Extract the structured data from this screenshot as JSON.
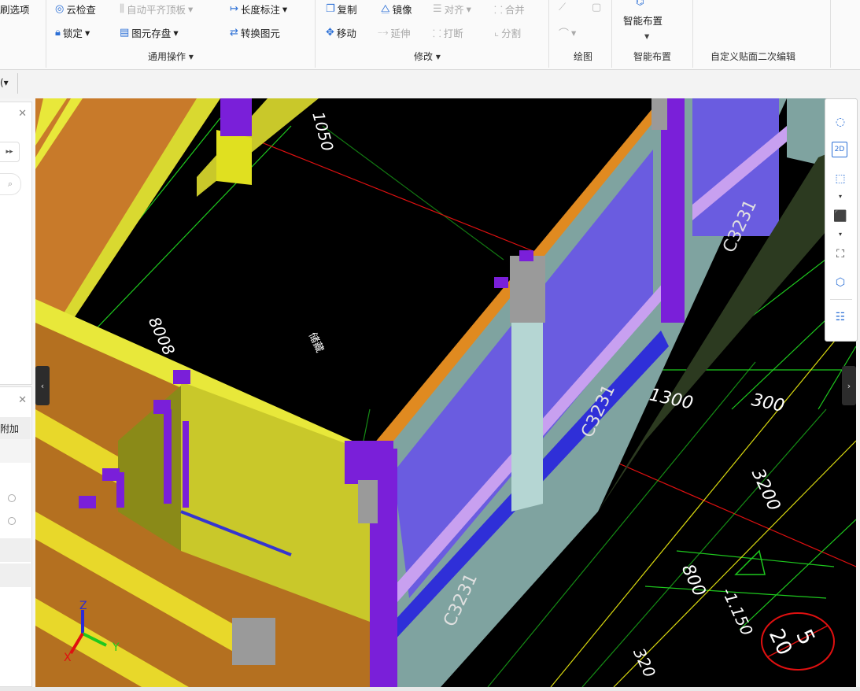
{
  "ribbon": {
    "row1": {
      "partial_left": "刷选项",
      "cloud_check": "云检查",
      "auto_align_slab": "自动平齐顶板",
      "length_dim": "长度标注",
      "copy": "复制",
      "mirror": "镜像",
      "align": "对齐",
      "merge": "合并"
    },
    "row2": {
      "lock": "锁定",
      "element_save": "图元存盘",
      "convert_element": "转换图元",
      "move": "移动",
      "extend": "延伸",
      "break": "打断",
      "split": "分割"
    },
    "smart_layout_btn": "智能布置",
    "groups": {
      "general_ops": "通用操作",
      "modify": "修改",
      "draw": "绘图",
      "smart_layout": "智能布置",
      "custom_face": "自定义贴面二次编辑"
    }
  },
  "subbar": {
    "partial_text": "(▾"
  },
  "left_panel": {
    "partial_label": "附加"
  },
  "canvas": {
    "dims": {
      "d1050": "1050",
      "d8008": "8008",
      "d1300": "1300",
      "d300": "300",
      "d3200": "3200",
      "d800": "800",
      "elev": "-1.150",
      "d320": "320"
    },
    "labels": {
      "c3231_a": "C3231",
      "c3231_b": "C3231",
      "c3231_c": "C3231",
      "room": "储藏",
      "circle_num": "5",
      "circle_sub": "20"
    },
    "axis": {
      "x": "X",
      "y": "Y",
      "z": "Z"
    }
  },
  "right_toolbar": {
    "btn_2d": "2D"
  },
  "colors": {
    "canvas_bg": "#000000",
    "slab_orange": "#c87a2a",
    "wall_yellow": "#c9c82a",
    "column_purple": "#7a1fd9",
    "window_blue": "#4a4ad8",
    "wall_grey": "#7fa3a0",
    "dim_green": "#1ec81e",
    "axis_red": "#e01010"
  }
}
